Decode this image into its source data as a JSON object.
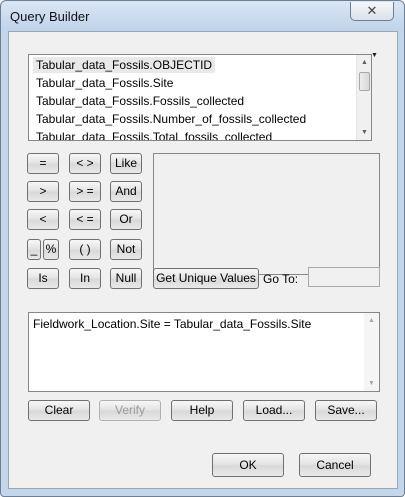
{
  "window": {
    "title": "Query Builder",
    "close_glyph": "✕"
  },
  "fields": {
    "items": [
      "Tabular_data_Fossils.OBJECTID",
      "Tabular_data_Fossils.Site",
      "Tabular_data_Fossils.Fossils_collected",
      "Tabular_data_Fossils.Number_of_fossils_collected",
      "Tabular_data_Fossils.Total_fossils_collected"
    ],
    "selected_index": 0,
    "dropdown_glyph": "▼"
  },
  "operators": {
    "equals": "=",
    "not_equals": "< >",
    "like": "Like",
    "greater": ">",
    "greater_equal": "> =",
    "and": "And",
    "less": "<",
    "less_equal": "< =",
    "or": "Or",
    "underscore": "_",
    "percent": "%",
    "parens": "( )",
    "not": "Not",
    "is": "Is",
    "in": "In",
    "null": "Null"
  },
  "values": {
    "get_unique_label": "Get Unique Values",
    "goto_label": "Go To:",
    "goto_value": ""
  },
  "expression": {
    "text": "Fieldwork_Location.Site = Tabular_data_Fossils.Site"
  },
  "scroll": {
    "up_glyph": "▲",
    "down_glyph": "▼"
  },
  "actions": {
    "clear": "Clear",
    "verify": "Verify",
    "help": "Help",
    "load": "Load...",
    "save": "Save..."
  },
  "dialog": {
    "ok": "OK",
    "cancel": "Cancel"
  }
}
